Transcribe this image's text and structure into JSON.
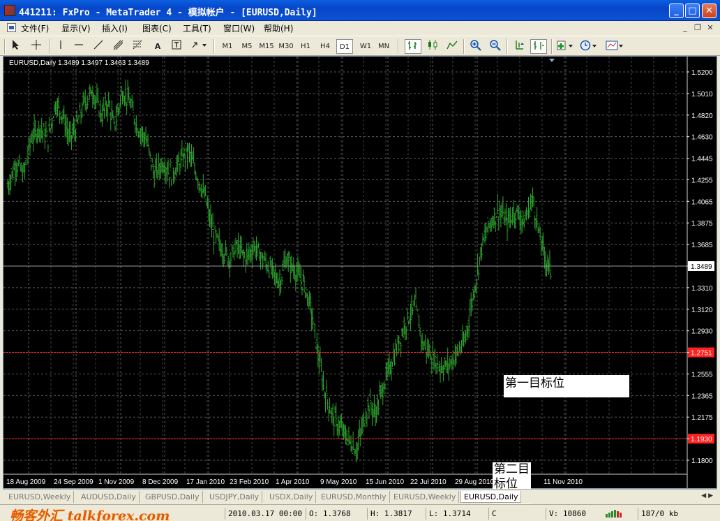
{
  "window": {
    "title": "441211: FxPro - MetaTrader 4 - 模拟帐户 - [EURUSD,Daily]",
    "minimize": "_",
    "maximize": "□",
    "close": "✕"
  },
  "menu": [
    "文件(F)",
    "显示(V)",
    "插入(I)",
    "图表(C)",
    "工具(T)",
    "窗口(W)",
    "帮助(H)"
  ],
  "mdi_controls": {
    "minimize": "_",
    "restore": "❐",
    "close": "✕"
  },
  "toolbar": {
    "tools": [
      "cursor",
      "crosshair",
      "vertical-line",
      "horizontal-line",
      "trend-line",
      "equidistant-channel",
      "fibonacci",
      "text",
      "text-label",
      "arrows"
    ],
    "tool_text_label": "A",
    "periods": [
      "M1",
      "M5",
      "M15",
      "M30",
      "H1",
      "H4",
      "D1",
      "W1",
      "MN"
    ],
    "active_period": "D1"
  },
  "chart": {
    "info_line": "EURUSD,Daily  1.3489 1.3497 1.3463 1.3489",
    "current_price_label": "1.3489",
    "target1_price_label": "1.2751",
    "target2_price_label": "1.1930",
    "annotation1": "第一目标位",
    "annotation2": "第二目标位"
  },
  "chart_data": {
    "type": "bar",
    "symbol": "EURUSD",
    "timeframe": "Daily",
    "last": {
      "open": 1.3489,
      "high": 1.3497,
      "low": 1.3463,
      "close": 1.3489
    },
    "price_axis_ticks": [
      "1.5200",
      "1.5010",
      "1.4820",
      "1.4630",
      "1.4445",
      "1.4255",
      "1.4065",
      "1.3875",
      "1.3685",
      "1.3489",
      "1.3310",
      "1.3120",
      "1.2930",
      "1.2751",
      "1.2555",
      "1.2365",
      "1.2175",
      "1.1930",
      "1.1800"
    ],
    "time_axis_ticks": [
      "18 Aug 2009",
      "24 Sep 2009",
      "1 Nov 2009",
      "8 Dec 2009",
      "17 Jan 2010",
      "23 Feb 2010",
      "1 Apr 2010",
      "9 May 2010",
      "15 Jun 2010",
      "22 Jul 2010",
      "29 Aug 2010",
      "11 Nov 2010"
    ],
    "ylim": [
      1.18,
      1.525
    ],
    "horizontal_levels": [
      {
        "name": "第一目标位",
        "value": 1.2751,
        "color": "#ff3030"
      },
      {
        "name": "第二目标位",
        "value": 1.193,
        "color": "#ff3030"
      }
    ],
    "close_path": [
      [
        0,
        1.42
      ],
      [
        8,
        1.44
      ],
      [
        15,
        1.43
      ],
      [
        22,
        1.46
      ],
      [
        30,
        1.47
      ],
      [
        38,
        1.46
      ],
      [
        45,
        1.49
      ],
      [
        52,
        1.48
      ],
      [
        58,
        1.46
      ],
      [
        65,
        1.47
      ],
      [
        72,
        1.49
      ],
      [
        80,
        1.5
      ],
      [
        88,
        1.48
      ],
      [
        95,
        1.49
      ],
      [
        100,
        1.47
      ],
      [
        108,
        1.5
      ],
      [
        115,
        1.49
      ],
      [
        122,
        1.47
      ],
      [
        130,
        1.46
      ],
      [
        138,
        1.43
      ],
      [
        146,
        1.44
      ],
      [
        154,
        1.43
      ],
      [
        162,
        1.44
      ],
      [
        170,
        1.45
      ],
      [
        178,
        1.43
      ],
      [
        186,
        1.41
      ],
      [
        194,
        1.38
      ],
      [
        200,
        1.37
      ],
      [
        208,
        1.36
      ],
      [
        216,
        1.37
      ],
      [
        224,
        1.36
      ],
      [
        232,
        1.37
      ],
      [
        240,
        1.36
      ],
      [
        248,
        1.35
      ],
      [
        256,
        1.34
      ],
      [
        262,
        1.36
      ],
      [
        270,
        1.35
      ],
      [
        278,
        1.34
      ],
      [
        285,
        1.32
      ],
      [
        292,
        1.28
      ],
      [
        298,
        1.25
      ],
      [
        305,
        1.23
      ],
      [
        312,
        1.22
      ],
      [
        320,
        1.21
      ],
      [
        328,
        1.2
      ],
      [
        334,
        1.22
      ],
      [
        340,
        1.24
      ],
      [
        346,
        1.23
      ],
      [
        352,
        1.25
      ],
      [
        360,
        1.27
      ],
      [
        368,
        1.29
      ],
      [
        376,
        1.31
      ],
      [
        384,
        1.32
      ],
      [
        390,
        1.29
      ],
      [
        398,
        1.28
      ],
      [
        406,
        1.27
      ],
      [
        414,
        1.27
      ],
      [
        422,
        1.28
      ],
      [
        430,
        1.29
      ],
      [
        438,
        1.33
      ],
      [
        446,
        1.37
      ],
      [
        454,
        1.39
      ],
      [
        462,
        1.4
      ],
      [
        470,
        1.39
      ],
      [
        478,
        1.4
      ],
      [
        486,
        1.39
      ],
      [
        494,
        1.41
      ],
      [
        500,
        1.38
      ],
      [
        506,
        1.36
      ],
      [
        512,
        1.348
      ]
    ],
    "x_units": "trading days since start of visible window"
  },
  "tabs": {
    "items": [
      "EURUSD,Weekly",
      "AUDUSD,Daily",
      "GBPUSD,Daily",
      "USDJPY,Daily",
      "USDX,Daily",
      "EURUSD,Monthly",
      "EURUSD,Weekly",
      "EURUSD,Daily"
    ],
    "active_index": 7
  },
  "status": {
    "watermark": "畅客外汇 talkforex.com",
    "datetime": "2010.03.17 00:00",
    "open": "O: 1.3768",
    "high": "H: 1.3817",
    "low": "L: 1.3714",
    "close_prefix": "C",
    "volume": "V: 10860",
    "traffic": "187/0 kb"
  },
  "colors": {
    "bars": "#2ea82e",
    "grid": "#6a6a6a",
    "levels": "#ff3030",
    "titlebar": "#0a52d6"
  }
}
